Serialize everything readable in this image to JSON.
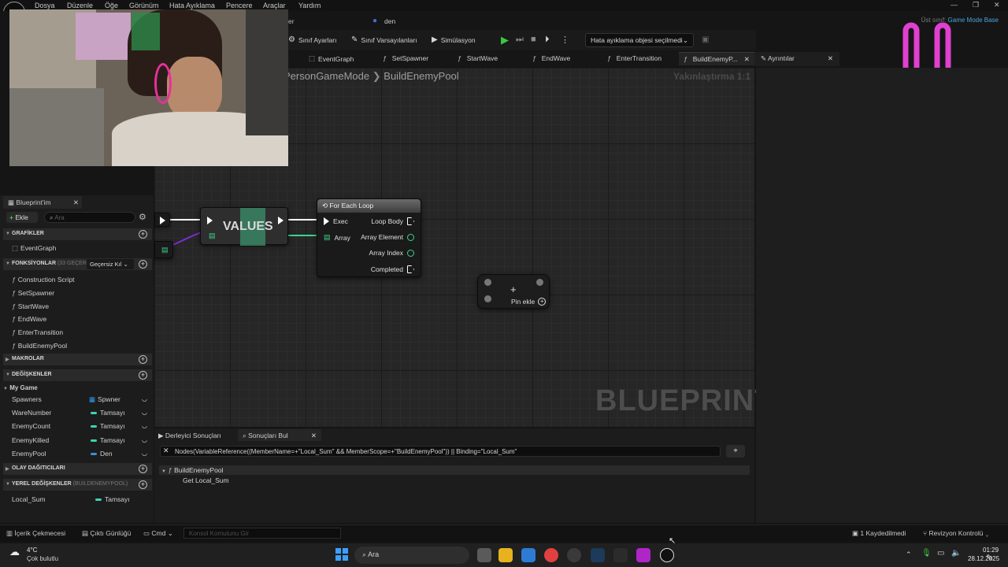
{
  "menu": [
    "Dosya",
    "Düzenle",
    "Öğe",
    "Görünüm",
    "Hata Ayıklama",
    "Pencere",
    "Araçlar",
    "Yardım"
  ],
  "title_strip": {
    "partial_title": "er",
    "user": "den",
    "parent_label": "Üst sınıf:",
    "parent_value": "Game Mode Base"
  },
  "toolbar": {
    "class_settings": "Sınıf Ayarları",
    "class_defaults": "Sınıf Varsayılanları",
    "simulation": "Simülasyon",
    "debug_select": "Hata ayıklama objesi seçilmedi"
  },
  "tabs": [
    "EventGraph",
    "SetSpawner",
    "StartWave",
    "EndWave",
    "EnterTransition",
    "BuildEnemyP..."
  ],
  "details_tab": "Ayrıntılar",
  "graph": {
    "breadcrumb": [
      "PersonGameMode",
      "BuildEnemyPool"
    ],
    "zoom": "Yakınlaştırma 1:1",
    "watermark": "BLUEPRINT",
    "values_node": "VALUES",
    "foreach": {
      "title": "For Each Loop",
      "exec": "Exec",
      "array": "Array",
      "loop_body": "Loop Body",
      "array_element": "Array Element",
      "array_index": "Array Index",
      "completed": "Completed"
    },
    "add_pin": "Pin ekle"
  },
  "my_blueprint": {
    "tab": "Blueprint'im",
    "add": "Ekle",
    "search_placeholder": "Ara",
    "graphs_header": "GRAFİKLER",
    "graphs": [
      "EventGraph"
    ],
    "functions_header": "FONKSİYONLAR",
    "functions_count": "(33 GEÇERSİ",
    "functions_filter": "Geçersiz Kıl",
    "functions": [
      "Construction Script",
      "SetSpawner",
      "StartWave",
      "EndWave",
      "EnterTransition",
      "BuildEnemyPool"
    ],
    "macros_header": "MAKROLAR",
    "variables_header": "DEĞİŞKENLER",
    "variables_category": "My Game",
    "variables": [
      {
        "name": "Spawners",
        "type": "Spwner",
        "color": "#2a9df4"
      },
      {
        "name": "WareNumber",
        "type": "Tamsayı",
        "color": "#3ed3b0"
      },
      {
        "name": "EnemyCount",
        "type": "Tamsayı",
        "color": "#3ed3b0"
      },
      {
        "name": "EnemyKilled",
        "type": "Tamsayı",
        "color": "#3ed3b0"
      },
      {
        "name": "EnemyPool",
        "type": "Den",
        "color": "#3a8fd8"
      }
    ],
    "dispatchers_header": "OLAY DAĞITICILARI",
    "locals_header": "YEREL DEĞİŞKENLER",
    "locals_scope": "(BUILDENEMYPOOL)",
    "locals": [
      {
        "name": "Local_Sum",
        "type": "Tamsayı",
        "color": "#3ed3b0"
      }
    ]
  },
  "results": {
    "tab_compiler": "Derleyici Sonuçları",
    "tab_find": "Sonuçları Bul",
    "query": "Nodes(VariableReference((MemberName=+\"Local_Sum\" && MemberScope=+\"BuildEnemyPool\")) || Binding=\"Local_Sum\"",
    "tree_root": "BuildEnemyPool",
    "tree_child": "Get Local_Sum"
  },
  "statusbar": {
    "content_drawer": "İçerik Çekmecesi",
    "output_log": "Çıktı Günlüğü",
    "cmd": "Cmd",
    "console_placeholder": "Konsol Komutunu Gir",
    "unsaved": "1 Kaydedilmedi",
    "revision": "Revizyon Kontrolü"
  },
  "taskbar": {
    "weather_temp": "4°C",
    "weather_desc": "Çok bulutlu",
    "search": "Ara",
    "time": "01:29",
    "date": "28.12.2025"
  },
  "colors": {
    "accent_blue": "#4aa3df",
    "play_green": "#38c93c",
    "int_pin": "#3ed3b0",
    "neon_pink": "#e040d0"
  }
}
